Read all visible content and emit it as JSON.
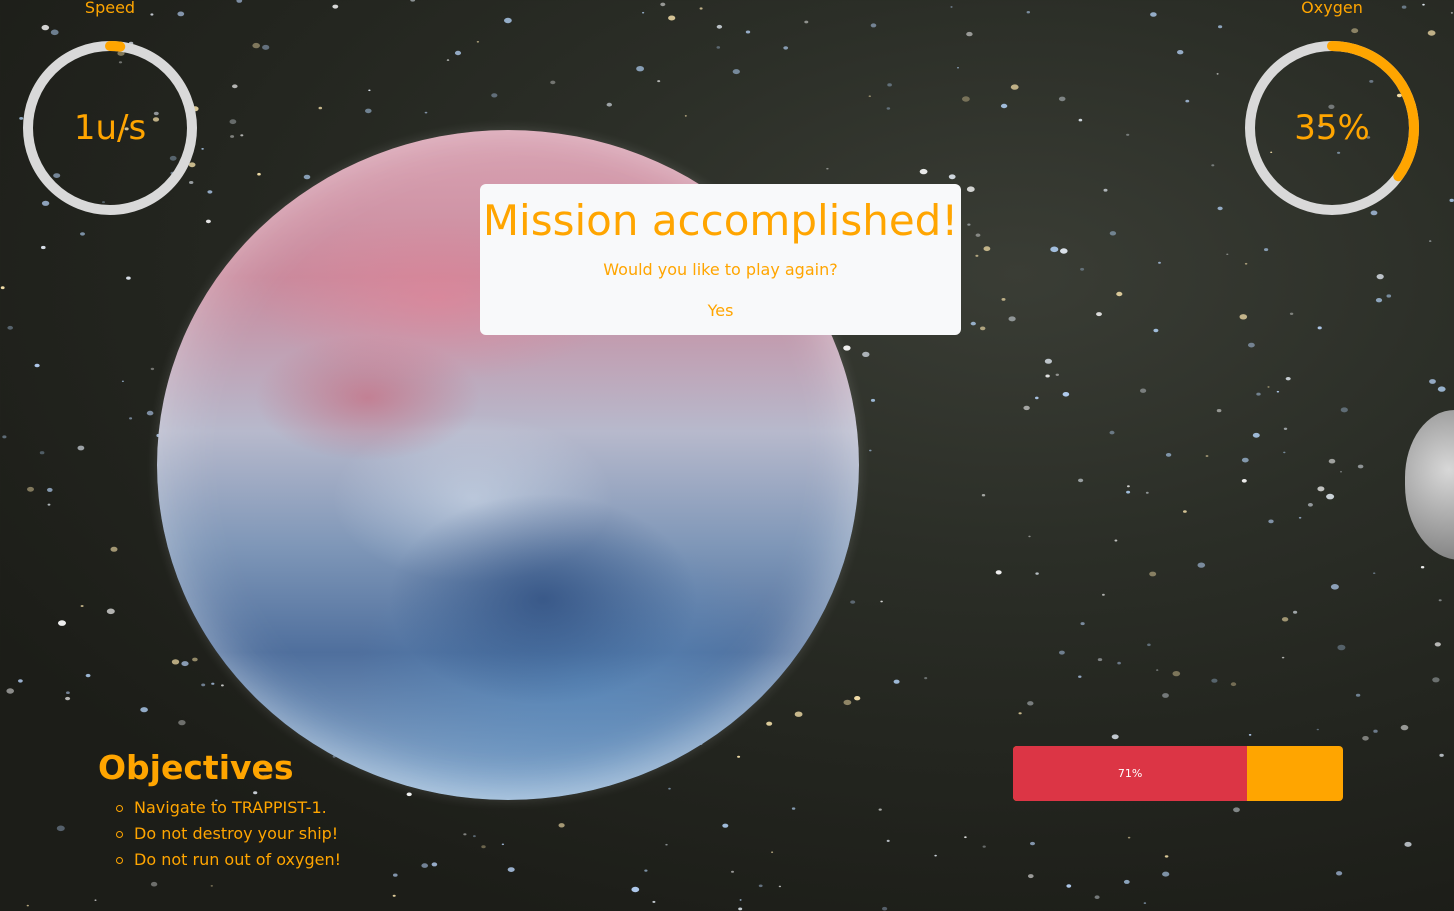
{
  "hud": {
    "speed": {
      "label": "Speed",
      "value": "1u/s",
      "fraction": 0.02
    },
    "oxygen": {
      "label": "Oxygen",
      "value": "35%",
      "fraction": 0.35
    }
  },
  "modal": {
    "title": "Mission accomplished!",
    "subtitle": "Would you like to play again?",
    "yes_label": "Yes"
  },
  "objectives": {
    "heading": "Objectives",
    "items": [
      "Navigate to TRAPPIST-1.",
      "Do not destroy your ship!",
      "Do not run out of oxygen!"
    ]
  },
  "progress": {
    "label": "71%",
    "fraction": 0.71
  },
  "colors": {
    "accent": "#ffa500",
    "track": "#d9d9d9",
    "progress_fill": "#dc3545",
    "modal_bg": "#f8f9fa"
  }
}
